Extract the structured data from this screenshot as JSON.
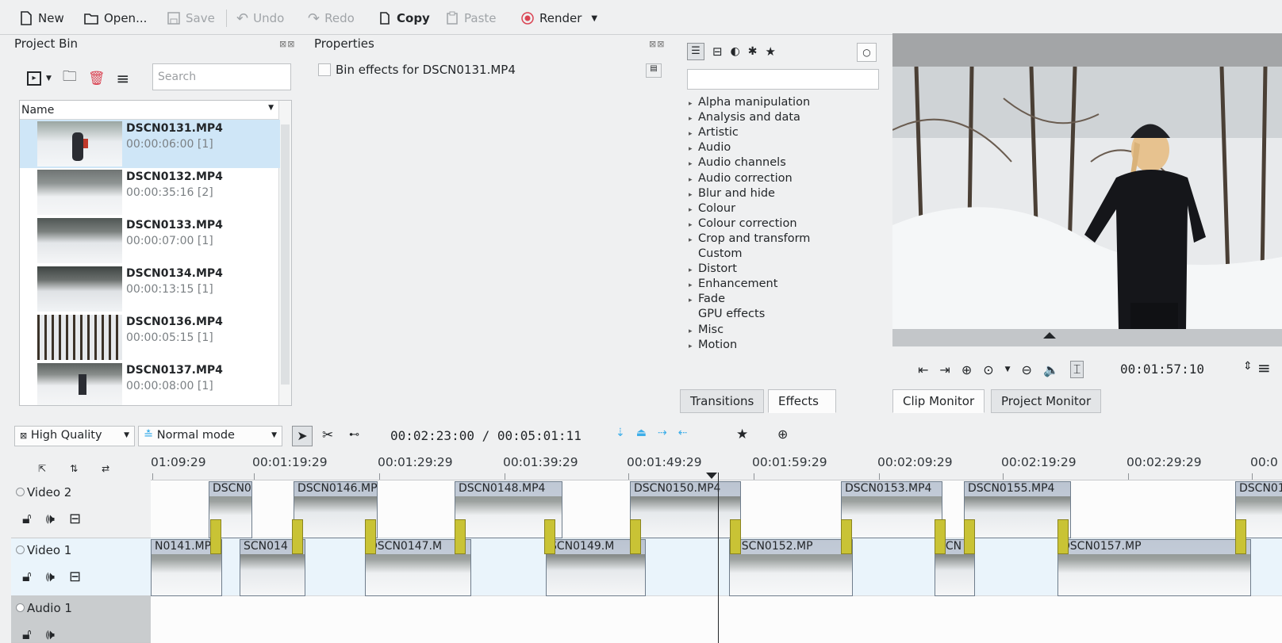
{
  "toolbar": {
    "new": "New",
    "open": "Open...",
    "save": "Save",
    "undo": "Undo",
    "redo": "Redo",
    "copy": "Copy",
    "paste": "Paste",
    "render": "Render"
  },
  "project_bin": {
    "title": "Project Bin",
    "search_placeholder": "Search",
    "column_name": "Name",
    "items": [
      {
        "name": "DSCN0131.MP4",
        "duration": "00:00:06:00 [1]"
      },
      {
        "name": "DSCN0132.MP4",
        "duration": "00:00:35:16 [2]"
      },
      {
        "name": "DSCN0133.MP4",
        "duration": "00:00:07:00 [1]"
      },
      {
        "name": "DSCN0134.MP4",
        "duration": "00:00:13:15 [1]"
      },
      {
        "name": "DSCN0136.MP4",
        "duration": "00:00:05:15 [1]"
      },
      {
        "name": "DSCN0137.MP4",
        "duration": "00:00:08:00 [1]"
      }
    ]
  },
  "properties": {
    "title": "Properties",
    "bin_effects_label": "Bin effects for DSCN0131.MP4"
  },
  "effects": {
    "categories": [
      {
        "label": "Alpha manipulation",
        "expandable": true
      },
      {
        "label": "Analysis and data",
        "expandable": true
      },
      {
        "label": "Artistic",
        "expandable": true
      },
      {
        "label": "Audio",
        "expandable": true
      },
      {
        "label": "Audio channels",
        "expandable": true
      },
      {
        "label": "Audio correction",
        "expandable": true
      },
      {
        "label": "Blur and hide",
        "expandable": true
      },
      {
        "label": "Colour",
        "expandable": true
      },
      {
        "label": "Colour correction",
        "expandable": true
      },
      {
        "label": "Crop and transform",
        "expandable": true
      },
      {
        "label": "Custom",
        "expandable": false
      },
      {
        "label": "Distort",
        "expandable": true
      },
      {
        "label": "Enhancement",
        "expandable": true
      },
      {
        "label": "Fade",
        "expandable": true
      },
      {
        "label": "GPU effects",
        "expandable": false
      },
      {
        "label": "Misc",
        "expandable": true
      },
      {
        "label": "Motion",
        "expandable": true
      }
    ],
    "tabs": [
      "Transitions",
      "Effects"
    ]
  },
  "monitor": {
    "timecode": "00:01:57:10",
    "tabs": [
      "Clip Monitor",
      "Project Monitor"
    ]
  },
  "timeline_toolbar": {
    "quality": "High Quality",
    "mode": "Normal mode",
    "position": "00:02:23:00 / 00:05:01:11"
  },
  "timeline": {
    "ruler": [
      "01:09:29",
      "00:01:19:29",
      "00:01:29:29",
      "00:01:39:29",
      "00:01:49:29",
      "00:01:59:29",
      "00:02:09:29",
      "00:02:19:29",
      "00:02:29:29",
      "00:0"
    ],
    "tracks": [
      {
        "name": "Video 2"
      },
      {
        "name": "Video 1"
      },
      {
        "name": "Audio 1"
      }
    ],
    "video2_clips": [
      "DSCN0",
      "DSCN0146.MP4",
      "DSCN0148.MP4",
      "DSCN0150.MP4",
      "DSCN0153.MP4",
      "DSCN0155.MP4",
      "DSCN01"
    ],
    "video1_clips": [
      "N0141.MP",
      "SCN014",
      "DSCN0147.M",
      "SCN0149.M",
      "DSCN0152.MP",
      "SCN",
      "DSCN0157.MP"
    ]
  }
}
